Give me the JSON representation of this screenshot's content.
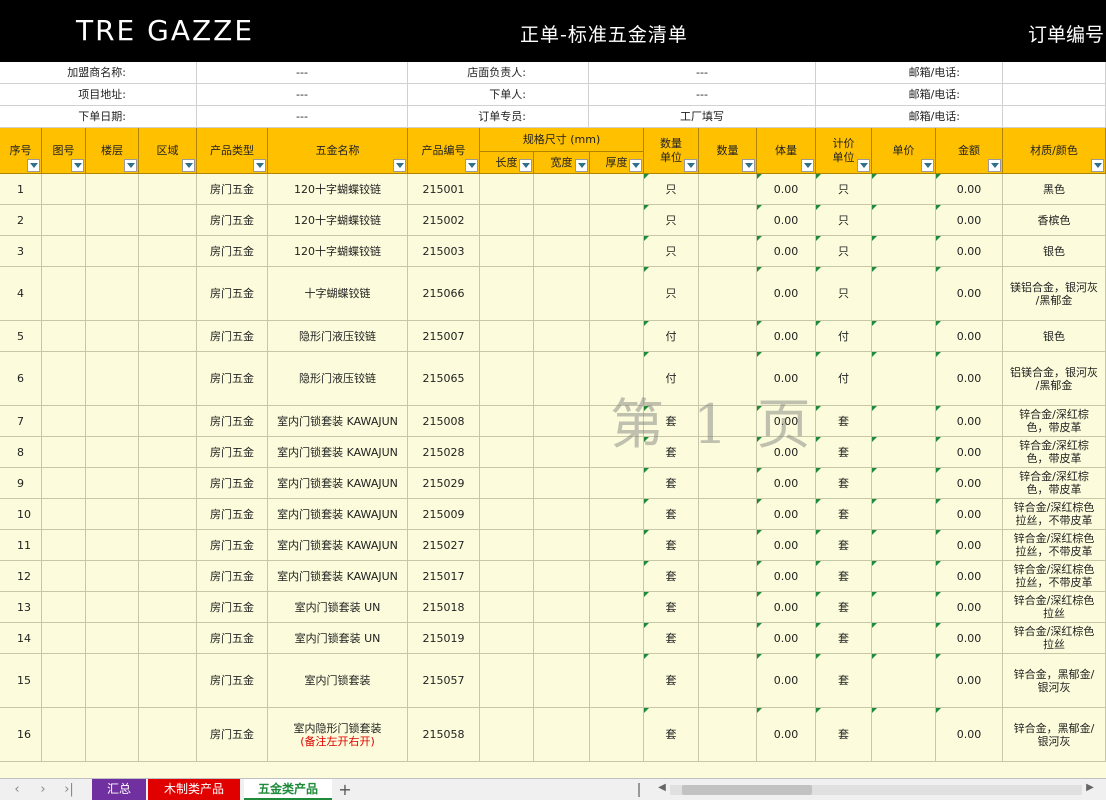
{
  "header": {
    "logo": "TRE GAZZE",
    "title": "正单-标准五金清单",
    "order_no_label": "订单编号"
  },
  "info_rows": [
    [
      {
        "text": "加盟商名称:",
        "w": "label"
      },
      {
        "text": "---"
      },
      {
        "text": "店面负责人:"
      },
      {
        "text": "---"
      },
      {
        "text": "邮箱/电话:"
      },
      {
        "text": ""
      }
    ],
    [
      {
        "text": "项目地址:"
      },
      {
        "text": "---"
      },
      {
        "text": "下单人:"
      },
      {
        "text": "---"
      },
      {
        "text": "邮箱/电话:"
      },
      {
        "text": ""
      }
    ],
    [
      {
        "text": "下单日期:"
      },
      {
        "text": "---"
      },
      {
        "text": "订单专员:"
      },
      {
        "text": "工厂填写"
      },
      {
        "text": "邮箱/电话:"
      },
      {
        "text": ""
      }
    ]
  ],
  "table_header": {
    "seq": "序号",
    "drawing_no": "图号",
    "floor": "楼层",
    "area": "区域",
    "product_type": "产品类型",
    "hardware_name": "五金名称",
    "product_code": "产品编号",
    "spec_group": "规格尺寸 (mm)",
    "length": "长度",
    "width": "宽度",
    "thickness": "厚度",
    "qty_unit": "数量\n单位",
    "qty": "数量",
    "volume": "体量",
    "price_unit": "计价\n单位",
    "unit_price": "单价",
    "amount": "金额",
    "material": "材质/颜色"
  },
  "rows": [
    {
      "seq": "1",
      "type": "房门五金",
      "name": "120十字蝴蝶铰链",
      "code": "215001",
      "unit": "只",
      "volume": "0.00",
      "price_unit": "只",
      "amount": "0.00",
      "material": "黑色"
    },
    {
      "seq": "2",
      "type": "房门五金",
      "name": "120十字蝴蝶铰链",
      "code": "215002",
      "unit": "只",
      "volume": "0.00",
      "price_unit": "只",
      "amount": "0.00",
      "material": "香槟色"
    },
    {
      "seq": "3",
      "type": "房门五金",
      "name": "120十字蝴蝶铰链",
      "code": "215003",
      "unit": "只",
      "volume": "0.00",
      "price_unit": "只",
      "amount": "0.00",
      "material": "银色"
    },
    {
      "seq": "4",
      "type": "房门五金",
      "name": "十字蝴蝶铰链",
      "code": "215066",
      "unit": "只",
      "volume": "0.00",
      "price_unit": "只",
      "amount": "0.00",
      "material": "镁铝合金，银河灰\n/黑郁金"
    },
    {
      "seq": "5",
      "type": "房门五金",
      "name": "隐形门液压铰链",
      "code": "215007",
      "unit": "付",
      "volume": "0.00",
      "price_unit": "付",
      "amount": "0.00",
      "material": "银色"
    },
    {
      "seq": "6",
      "type": "房门五金",
      "name": "隐形门液压铰链",
      "code": "215065",
      "unit": "付",
      "volume": "0.00",
      "price_unit": "付",
      "amount": "0.00",
      "material": "铝镁合金，银河灰\n/黑郁金"
    },
    {
      "seq": "7",
      "type": "房门五金",
      "name": "室内门锁套装 KAWAJUN",
      "code": "215008",
      "unit": "套",
      "volume": "0.00",
      "price_unit": "套",
      "amount": "0.00",
      "material": "锌合金/深红棕\n色，带皮革"
    },
    {
      "seq": "8",
      "type": "房门五金",
      "name": "室内门锁套装 KAWAJUN",
      "code": "215028",
      "unit": "套",
      "volume": "0.00",
      "price_unit": "套",
      "amount": "0.00",
      "material": "锌合金/深红棕\n色，带皮革"
    },
    {
      "seq": "9",
      "type": "房门五金",
      "name": "室内门锁套装 KAWAJUN",
      "code": "215029",
      "unit": "套",
      "volume": "0.00",
      "price_unit": "套",
      "amount": "0.00",
      "material": "锌合金/深红棕\n色，带皮革"
    },
    {
      "seq": "10",
      "type": "房门五金",
      "name": "室内门锁套装 KAWAJUN",
      "code": "215009",
      "unit": "套",
      "volume": "0.00",
      "price_unit": "套",
      "amount": "0.00",
      "material": "锌合金/深红棕色\n拉丝，不带皮革"
    },
    {
      "seq": "11",
      "type": "房门五金",
      "name": "室内门锁套装 KAWAJUN",
      "code": "215027",
      "unit": "套",
      "volume": "0.00",
      "price_unit": "套",
      "amount": "0.00",
      "material": "锌合金/深红棕色\n拉丝，不带皮革"
    },
    {
      "seq": "12",
      "type": "房门五金",
      "name": "室内门锁套装 KAWAJUN",
      "code": "215017",
      "unit": "套",
      "volume": "0.00",
      "price_unit": "套",
      "amount": "0.00",
      "material": "锌合金/深红棕色\n拉丝，不带皮革"
    },
    {
      "seq": "13",
      "type": "房门五金",
      "name": "室内门锁套装 UN",
      "code": "215018",
      "unit": "套",
      "volume": "0.00",
      "price_unit": "套",
      "amount": "0.00",
      "material": "锌合金/深红棕色\n拉丝"
    },
    {
      "seq": "14",
      "type": "房门五金",
      "name": "室内门锁套装 UN",
      "code": "215019",
      "unit": "套",
      "volume": "0.00",
      "price_unit": "套",
      "amount": "0.00",
      "material": "锌合金/深红棕色\n拉丝"
    },
    {
      "seq": "15",
      "type": "房门五金",
      "name": "室内门锁套装",
      "code": "215057",
      "unit": "套",
      "volume": "0.00",
      "price_unit": "套",
      "amount": "0.00",
      "material": "锌合金，黑郁金/\n银河灰"
    },
    {
      "seq": "16",
      "type": "房门五金",
      "name": "室内隐形门锁套装",
      "name_note": "(备注左开右开)",
      "code": "215058",
      "unit": "套",
      "volume": "0.00",
      "price_unit": "套",
      "amount": "0.00",
      "material": "锌合金，黑郁金/\n银河灰"
    }
  ],
  "watermark": "第 1 页",
  "sheet_tabs": [
    {
      "label": "汇总",
      "bg": "#7030a0",
      "color": "#ffffff"
    },
    {
      "label": "木制类产品",
      "bg": "#e00000",
      "color": "#ffffff"
    },
    {
      "label": "五金类产品",
      "bg": "#ffffff",
      "color": "#1e8b3a"
    }
  ],
  "add_sheet": "+",
  "colors": {
    "header_bg": "#000000",
    "table_header_bg": "#ffc000",
    "row_bg": "#fcfcdc",
    "accent_green": "#1e8b3a"
  }
}
